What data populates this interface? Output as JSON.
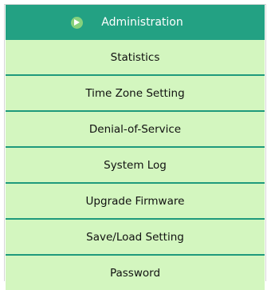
{
  "menu": {
    "header": {
      "label": "Administration",
      "icon": "play-circle-icon",
      "header_color": "#23a183",
      "icon_color": "#86d17c"
    },
    "items": [
      {
        "label": "Statistics"
      },
      {
        "label": "Time Zone Setting"
      },
      {
        "label": "Denial-of-Service"
      },
      {
        "label": "System Log"
      },
      {
        "label": "Upgrade Firmware"
      },
      {
        "label": "Save/Load Setting"
      },
      {
        "label": "Password"
      }
    ],
    "item_bg_color": "#d3f6bf",
    "divider_color": "#1f9a7c"
  }
}
